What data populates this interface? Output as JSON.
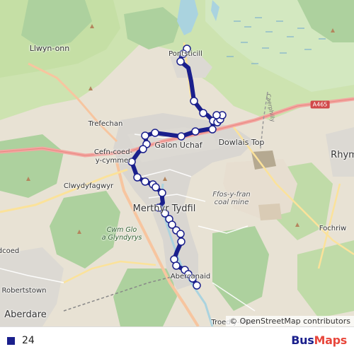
{
  "map": {
    "places": [
      {
        "id": "llwyn-onn",
        "text": "Llwyn-onn"
      },
      {
        "id": "pontsticill",
        "text": "Pontsticill"
      },
      {
        "id": "trefechan",
        "text": "Trefechan"
      },
      {
        "id": "cefn-coed",
        "text": "Cefn-coed-\ny-cymmer"
      },
      {
        "id": "galon-uchaf",
        "text": "Galon Uchaf"
      },
      {
        "id": "dowlais-top",
        "text": "Dowlais Top"
      },
      {
        "id": "rhymney",
        "text": "Rhym"
      },
      {
        "id": "clwydyfagwyr",
        "text": "Clwydyfagwyr"
      },
      {
        "id": "ffos-y-fran",
        "text": "Ffos-y-fran\ncoal mine"
      },
      {
        "id": "merthyr",
        "text": "Merthyr Tydfil"
      },
      {
        "id": "cwm-glo",
        "text": "Cwm Glo\na Glyndyrys"
      },
      {
        "id": "fochriw",
        "text": "Fochriw"
      },
      {
        "id": "llwydcoed",
        "text": "dcoed"
      },
      {
        "id": "robertstown",
        "text": "Robertstown"
      },
      {
        "id": "abercanaid",
        "text": "Abercanaid"
      },
      {
        "id": "aberdare",
        "text": "Aberdare"
      },
      {
        "id": "troed-y-rhiw",
        "text": "Troed-y-rhiw"
      },
      {
        "id": "caerphilly",
        "text": "Caerphilly"
      }
    ],
    "roads": [
      {
        "id": "a465",
        "text": "A465"
      }
    ],
    "attribution": "© OpenStreetMap contributors"
  },
  "route": {
    "name": "24",
    "color": "#1a1f8c"
  },
  "legend": {
    "route_label": "24",
    "brand_part1": "Bus",
    "brand_part2": "Maps"
  }
}
